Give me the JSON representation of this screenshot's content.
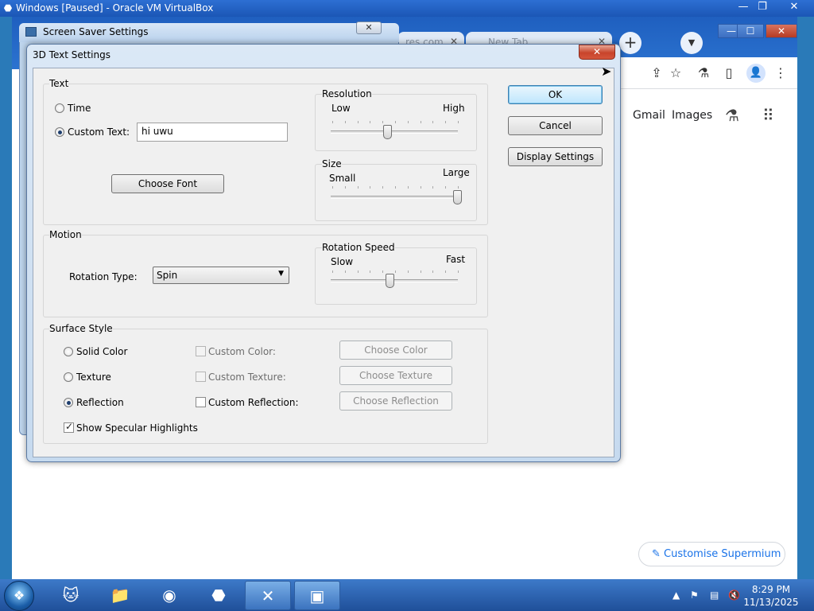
{
  "vbox": {
    "title": "Windows [Paused] - Oracle VM VirtualBox",
    "minimize": "—",
    "restore": "❐",
    "close": "✕"
  },
  "browser": {
    "tabs": [
      {
        "label": "res.com",
        "close": "✕"
      },
      {
        "label": "New Tab",
        "close": "✕"
      }
    ],
    "new_tab": "+",
    "tab_search": "▼",
    "minimize": "—",
    "maximize": "☐",
    "close": "✕",
    "toolbar_icons": [
      "share-icon",
      "star-icon",
      "labs-icon",
      "sidepanel-icon",
      "profile-icon",
      "menu-icon"
    ],
    "ntp_links": [
      "Gmail",
      "Images"
    ],
    "customise_label": "Customise Supermium"
  },
  "screensaver_window": {
    "title": "Screen Saver Settings",
    "close": "✕"
  },
  "dialog": {
    "title": "3D Text Settings",
    "close": "✕",
    "text_group": {
      "label": "Text",
      "time_label": "Time",
      "custom_text_label": "Custom Text:",
      "custom_text_value": "hi uwu",
      "choose_font": "Choose Font",
      "selected": "custom"
    },
    "resolution": {
      "label": "Resolution",
      "low": "Low",
      "high": "High",
      "value": 0.45
    },
    "size": {
      "label": "Size",
      "small": "Small",
      "large": "Large",
      "value": 1.0
    },
    "motion_group": {
      "label": "Motion",
      "rotation_type_label": "Rotation Type:",
      "rotation_type_value": "Spin"
    },
    "rotation_speed": {
      "label": "Rotation Speed",
      "slow": "Slow",
      "fast": "Fast",
      "value": 0.47
    },
    "surface_group": {
      "label": "Surface Style",
      "solid_color": "Solid Color",
      "texture": "Texture",
      "reflection": "Reflection",
      "custom_color": "Custom Color:",
      "custom_texture": "Custom Texture:",
      "custom_reflection": "Custom Reflection:",
      "choose_color": "Choose Color",
      "choose_texture": "Choose Texture",
      "choose_reflection": "Choose Reflection",
      "show_specular": "Show Specular Highlights",
      "selected": "reflection"
    },
    "ok": "OK",
    "cancel": "Cancel",
    "display_settings": "Display Settings"
  },
  "taskbar": {
    "clock_time": "8:29 PM",
    "clock_date": "11/13/2025",
    "tray_show_hidden": "▲",
    "apps": [
      "cat-app-icon",
      "explorer-icon",
      "chrome-icon",
      "virtualbox-icon",
      "vista-icon",
      "screen-saver-icon"
    ]
  }
}
